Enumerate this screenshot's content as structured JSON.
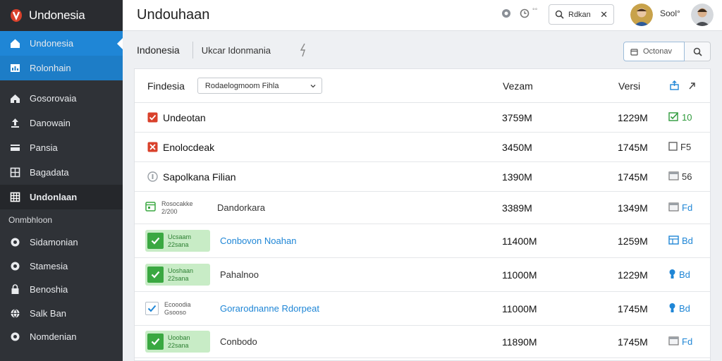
{
  "brand": {
    "name": "Undonesia"
  },
  "sidebar": {
    "items": [
      {
        "label": "Undonesia",
        "icon": "home-icon",
        "state": "active"
      },
      {
        "label": "Rolonhain",
        "icon": "chart-icon",
        "state": "active2"
      },
      {
        "label": "Gosorovaia",
        "icon": "house-icon",
        "state": ""
      },
      {
        "label": "Danowain",
        "icon": "upload-icon",
        "state": ""
      },
      {
        "label": "Pansia",
        "icon": "card-icon",
        "state": ""
      },
      {
        "label": "Bagadata",
        "icon": "grid-icon",
        "state": ""
      },
      {
        "label": "Undonlaan",
        "icon": "table-icon",
        "state": "bold"
      }
    ],
    "section": "Onmbhloon",
    "items2": [
      {
        "label": "Sidamonian",
        "icon": "circle-icon"
      },
      {
        "label": "Stamesia",
        "icon": "circle-icon"
      },
      {
        "label": "Benoshia",
        "icon": "lock-icon"
      },
      {
        "label": "Salk Ban",
        "icon": "globe-icon"
      },
      {
        "label": "Nomdenian",
        "icon": "circle-icon"
      }
    ]
  },
  "topbar": {
    "title": "Undouhaan",
    "search_text": "Rdkan",
    "user_name": "Sool°"
  },
  "subbar": {
    "title": "Indonesia",
    "crumb": "Ukcar Idonmania",
    "search_text": "Octonav"
  },
  "table": {
    "header": {
      "name": "Findesia",
      "filter": "Rodaelogmoom Fihla",
      "size": "Vezam",
      "version": "Versi"
    },
    "rows": [
      {
        "kind": "simple",
        "icon": "red-check-icon",
        "name": "Undeotan",
        "size": "3759M",
        "version": "1229M",
        "act_icon": "green-check-icon",
        "act_text": "10",
        "act_color": "green",
        "name_blue": false,
        "height": 42
      },
      {
        "kind": "simple",
        "icon": "red-x-icon",
        "name": "Enolocdeak",
        "size": "3450M",
        "version": "1745M",
        "act_icon": "square-icon",
        "act_text": "F5",
        "act_color": "",
        "name_blue": false,
        "height": 42
      },
      {
        "kind": "simple",
        "icon": "gray-circle-icon",
        "name": "Sapolkana Filian",
        "size": "1390M",
        "version": "1745M",
        "act_icon": "doc-icon",
        "act_text": "56",
        "act_color": "",
        "name_blue": false,
        "height": 42
      },
      {
        "kind": "plain-chip",
        "icon": "green-calendar-icon",
        "chip1": "Rosocakke",
        "chip2": "2/200",
        "name": "Dandorkara",
        "size": "3389M",
        "version": "1349M",
        "act_icon": "doc-icon",
        "act_text": "Fd",
        "act_color": "blue",
        "name_blue": false,
        "height": 46
      },
      {
        "kind": "green-chip",
        "chip1": "Ucsaam",
        "chip2": "22sana",
        "name": "Conbovon Noahan",
        "size": "11400M",
        "version": "1259M",
        "act_icon": "blue-box-icon",
        "act_text": "Bd",
        "act_color": "blue",
        "name_blue": true,
        "height": 48
      },
      {
        "kind": "green-chip",
        "chip1": "Uoshaan",
        "chip2": "22sana",
        "name": "Pahalnoo",
        "size": "11000M",
        "version": "1229M",
        "act_icon": "blue-pin-icon",
        "act_text": "Bd",
        "act_color": "blue",
        "name_blue": false,
        "height": 48
      },
      {
        "kind": "light-chip",
        "chip1": "Ecooodia",
        "chip2": "Gsooso",
        "name": "Gorarodnanne Rdorpeat",
        "size": "11000M",
        "version": "1745M",
        "act_icon": "blue-pin-icon",
        "act_text": "Bd",
        "act_color": "blue",
        "name_blue": true,
        "height": 48
      },
      {
        "kind": "green-chip",
        "chip1": "Uooban",
        "chip2": "22sana",
        "name": "Conbodo",
        "size": "11890M",
        "version": "1745M",
        "act_icon": "doc-icon",
        "act_text": "Fd",
        "act_color": "blue",
        "name_blue": false,
        "height": 46
      }
    ]
  },
  "colors": {
    "accent": "#1f86d6",
    "sidebar": "#2f3237",
    "green": "#3aa841",
    "red": "#d9412b"
  }
}
